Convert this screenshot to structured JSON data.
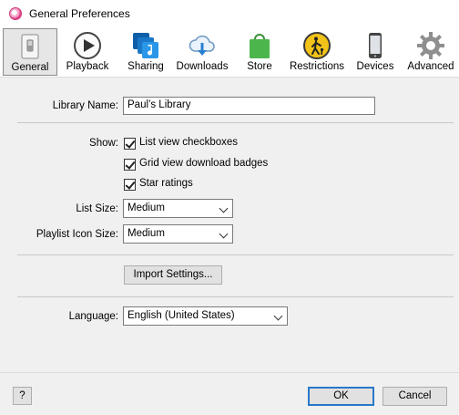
{
  "window": {
    "title": "General Preferences"
  },
  "toolbar": {
    "tabs": [
      {
        "label": "General",
        "icon": "switch-icon"
      },
      {
        "label": "Playback",
        "icon": "play-icon"
      },
      {
        "label": "Sharing",
        "icon": "sharing-icon"
      },
      {
        "label": "Downloads",
        "icon": "download-cloud-icon"
      },
      {
        "label": "Store",
        "icon": "store-bag-icon"
      },
      {
        "label": "Restrictions",
        "icon": "restrictions-icon"
      },
      {
        "label": "Devices",
        "icon": "phone-icon"
      },
      {
        "label": "Advanced",
        "icon": "gear-icon"
      }
    ],
    "active": "General"
  },
  "general": {
    "library_name_label": "Library Name:",
    "library_name_value": "Paul’s Library",
    "show_label": "Show:",
    "checkboxes": [
      {
        "label": "List view checkboxes",
        "checked": true
      },
      {
        "label": "Grid view download badges",
        "checked": true
      },
      {
        "label": "Star ratings",
        "checked": true
      }
    ],
    "list_size_label": "List Size:",
    "list_size_value": "Medium",
    "playlist_icon_size_label": "Playlist Icon Size:",
    "playlist_icon_size_value": "Medium",
    "import_settings_label": "Import Settings...",
    "language_label": "Language:",
    "language_value": "English (United States)"
  },
  "footer": {
    "help_label": "?",
    "ok_label": "OK",
    "cancel_label": "Cancel"
  },
  "colors": {
    "store_green": "#4cb64c",
    "sharing_blue": "#1e88d8",
    "restrictions_yellow": "#f2c318",
    "accent_blue": "#2878c8"
  }
}
